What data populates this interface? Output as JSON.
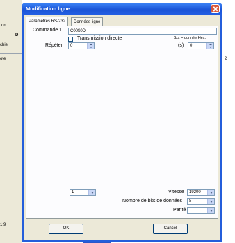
{
  "background": {
    "fragments": [
      "on",
      "D",
      "chie",
      "ote",
      "1:9",
      "2"
    ]
  },
  "dialog": {
    "title": "Modification ligne",
    "tabs": [
      {
        "label": "Paramètres RS-232",
        "active": true
      },
      {
        "label": "Données ligne",
        "active": false
      }
    ],
    "commande_label": "Commande 1",
    "commande_value": "C00$0D",
    "transmission_label": "Transmission directe",
    "transmission_checked": false,
    "hex_note": "$xx = donnée Hex.",
    "repeter_label": "Répéter",
    "repeter_value": "0",
    "seconds_label": "(s)",
    "seconds_value": "0",
    "port_value": "1",
    "vitesse_label": "Vitesse",
    "vitesse_value": "19200",
    "bits_label": "Nombre de bits de données",
    "bits_value": "8",
    "parite_label": "Parité",
    "parite_value": "-",
    "ok_label": "OK",
    "cancel_label": "Cancel"
  }
}
